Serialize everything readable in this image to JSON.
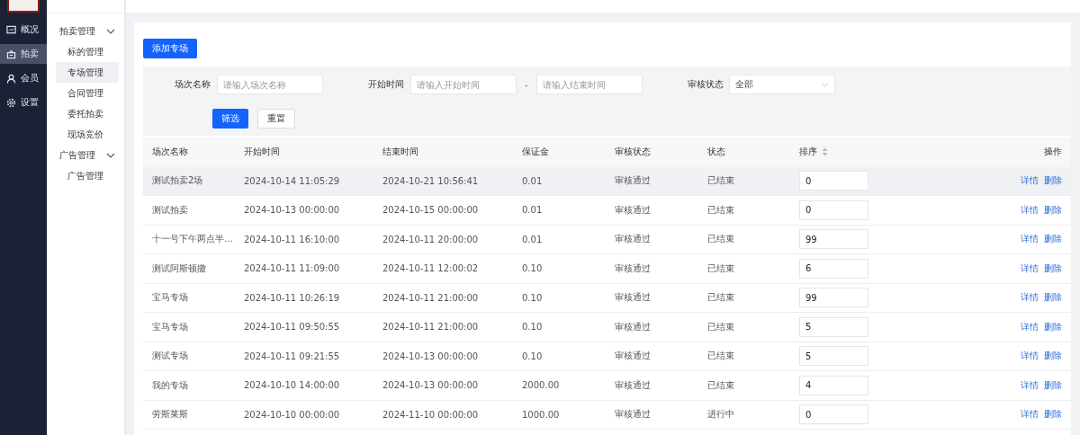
{
  "nav": [
    {
      "label": "概况",
      "selected": false
    },
    {
      "label": "拍卖",
      "selected": true
    },
    {
      "label": "会员",
      "selected": false
    },
    {
      "label": "设置",
      "selected": false
    }
  ],
  "submenu": [
    {
      "label": "拍卖管理",
      "expanded": true,
      "children": [
        {
          "label": "标的管理",
          "selected": false
        },
        {
          "label": "专场管理",
          "selected": true
        },
        {
          "label": "合同管理",
          "selected": false
        },
        {
          "label": "委托拍卖",
          "selected": false
        },
        {
          "label": "现场竞价",
          "selected": false
        }
      ]
    },
    {
      "label": "广告管理",
      "expanded": true,
      "children": [
        {
          "label": "广告管理",
          "selected": false
        }
      ]
    }
  ],
  "add_button": "添加专场",
  "filters": {
    "name_label": "场次名称",
    "name_placeholder": "请输入场次名称",
    "time_label": "开始时间",
    "start_placeholder": "请输入开始时间",
    "separator": "-",
    "end_placeholder": "请输入结束时间",
    "status_label": "审核状态",
    "status_value": "全部",
    "filter_button": "筛选",
    "reset_button": "重置"
  },
  "table": {
    "columns": [
      "场次名称",
      "开始时间",
      "结束时间",
      "保证金",
      "审核状态",
      "状态",
      "排序",
      "操作"
    ],
    "rows": [
      {
        "name": "测试拍卖2场",
        "start": "2024-10-14 11:05:29",
        "end": "2024-10-21 10:56:41",
        "deposit": "0.01",
        "audit": "审核通过",
        "status": "已结束",
        "sort": "0",
        "hovered": true,
        "actions": [
          "详情",
          "删除"
        ]
      },
      {
        "name": "测试拍卖",
        "start": "2024-10-13 00:00:00",
        "end": "2024-10-15 00:00:00",
        "deposit": "0.01",
        "audit": "审核通过",
        "status": "已结束",
        "sort": "0",
        "hovered": false,
        "actions": [
          "详情",
          "删除"
        ]
      },
      {
        "name": "十一号下午两点半…",
        "start": "2024-10-11 16:10:00",
        "end": "2024-10-11 20:00:00",
        "deposit": "0.01",
        "audit": "审核通过",
        "status": "已结束",
        "sort": "99",
        "hovered": false,
        "actions": [
          "详情",
          "删除"
        ]
      },
      {
        "name": "测试阿斯顿撒",
        "start": "2024-10-11 11:09:00",
        "end": "2024-10-11 12:00:02",
        "deposit": "0.10",
        "audit": "审核通过",
        "status": "已结束",
        "sort": "6",
        "hovered": false,
        "actions": [
          "详情",
          "删除"
        ]
      },
      {
        "name": "宝马专场",
        "start": "2024-10-11 10:26:19",
        "end": "2024-10-11 21:00:00",
        "deposit": "0.10",
        "audit": "审核通过",
        "status": "已结束",
        "sort": "99",
        "hovered": false,
        "actions": [
          "详情",
          "删除"
        ]
      },
      {
        "name": "宝马专场",
        "start": "2024-10-11 09:50:55",
        "end": "2024-10-11 21:00:00",
        "deposit": "0.10",
        "audit": "审核通过",
        "status": "已结束",
        "sort": "5",
        "hovered": false,
        "actions": [
          "详情",
          "删除"
        ]
      },
      {
        "name": "测试专场",
        "start": "2024-10-11 09:21:55",
        "end": "2024-10-13 00:00:00",
        "deposit": "0.10",
        "audit": "审核通过",
        "status": "已结束",
        "sort": "5",
        "hovered": false,
        "actions": [
          "详情",
          "删除"
        ]
      },
      {
        "name": "我的专场",
        "start": "2024-10-10 14:00:00",
        "end": "2024-10-13 00:00:00",
        "deposit": "2000.00",
        "audit": "审核通过",
        "status": "已结束",
        "sort": "4",
        "hovered": false,
        "actions": [
          "详情",
          "删除"
        ]
      },
      {
        "name": "劳斯莱斯",
        "start": "2024-10-10 00:00:00",
        "end": "2024-11-10 00:00:00",
        "deposit": "1000.00",
        "audit": "审核通过",
        "status": "进行中",
        "sort": "0",
        "hovered": false,
        "actions": [
          "详情",
          "删除"
        ]
      }
    ]
  }
}
